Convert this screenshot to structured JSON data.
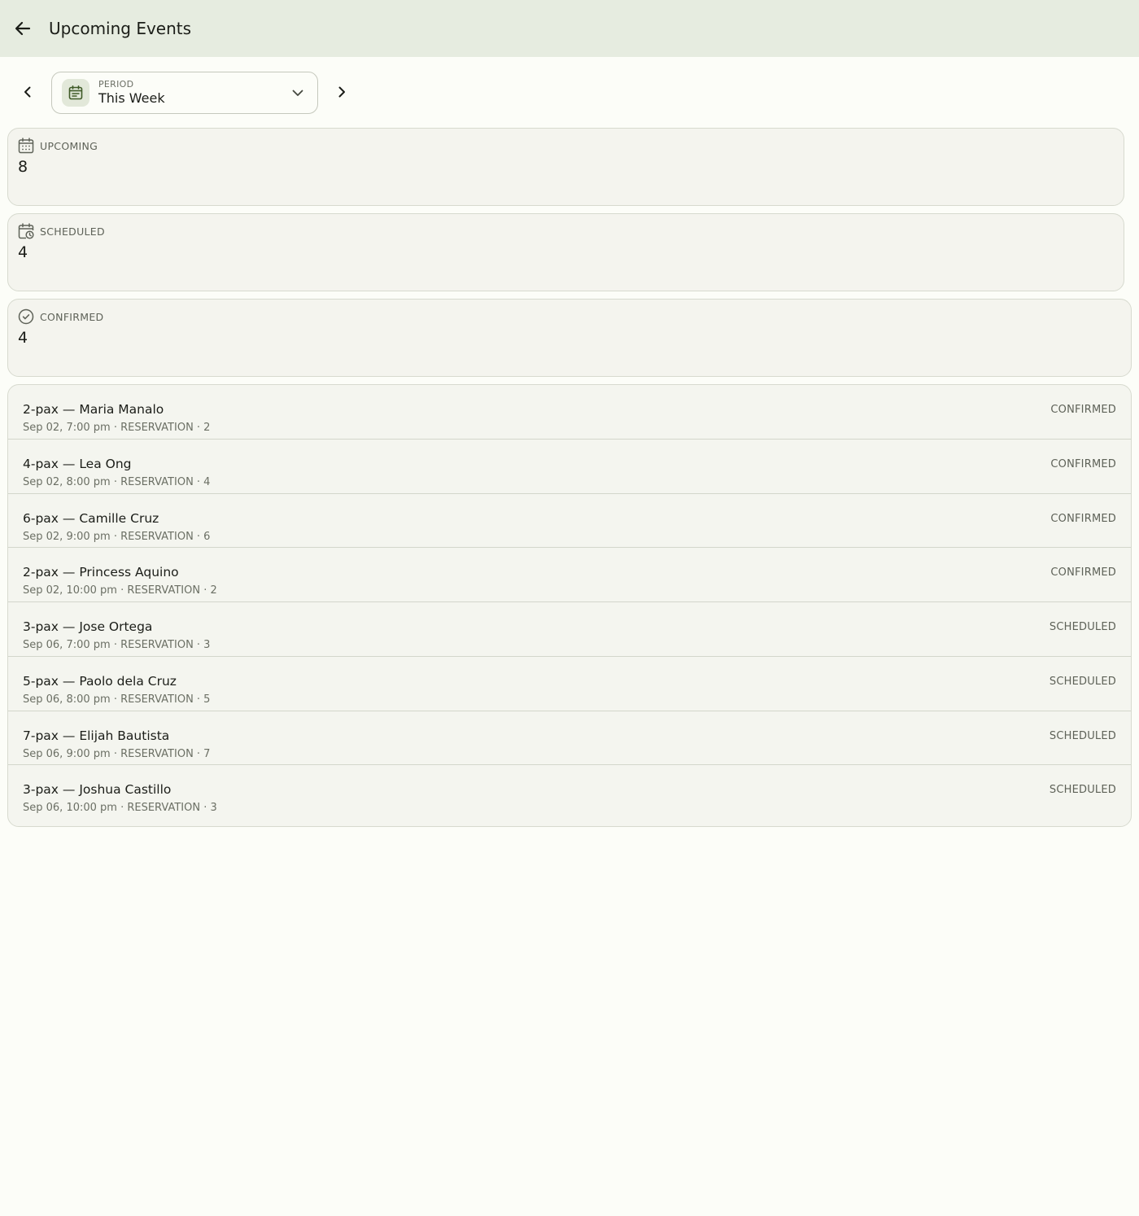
{
  "appbar": {
    "title": "Upcoming Events",
    "back_icon": "arrow-left-icon"
  },
  "period": {
    "label": "PERIOD",
    "value": "This Week",
    "icon": "calendar-list-icon",
    "prev_icon": "chevron-left-icon",
    "next_icon": "chevron-right-icon",
    "dropdown_icon": "chevron-down-icon"
  },
  "stats": [
    {
      "label": "UPCOMING",
      "value": "8",
      "icon": "calendar-grid-icon"
    },
    {
      "label": "SCHEDULED",
      "value": "4",
      "icon": "calendar-clock-icon"
    },
    {
      "label": "CONFIRMED",
      "value": "4",
      "icon": "check-circle-icon"
    }
  ],
  "events": [
    {
      "title": "2-pax — Maria Manalo",
      "subtitle": "Sep 02, 7:00 pm · RESERVATION · 2",
      "status": "CONFIRMED"
    },
    {
      "title": "4-pax — Lea Ong",
      "subtitle": "Sep 02, 8:00 pm · RESERVATION · 4",
      "status": "CONFIRMED"
    },
    {
      "title": "6-pax — Camille Cruz",
      "subtitle": "Sep 02, 9:00 pm · RESERVATION · 6",
      "status": "CONFIRMED"
    },
    {
      "title": "2-pax — Princess Aquino",
      "subtitle": "Sep 02, 10:00 pm · RESERVATION · 2",
      "status": "CONFIRMED"
    },
    {
      "title": "3-pax — Jose Ortega",
      "subtitle": "Sep 06, 7:00 pm · RESERVATION · 3",
      "status": "SCHEDULED"
    },
    {
      "title": "5-pax — Paolo dela Cruz",
      "subtitle": "Sep 06, 8:00 pm · RESERVATION · 5",
      "status": "SCHEDULED"
    },
    {
      "title": "7-pax — Elijah Bautista",
      "subtitle": "Sep 06, 9:00 pm · RESERVATION · 7",
      "status": "SCHEDULED"
    },
    {
      "title": "3-pax — Joshua Castillo",
      "subtitle": "Sep 06, 10:00 pm · RESERVATION · 3",
      "status": "SCHEDULED"
    }
  ],
  "colors": {
    "appbar_bg": "#e6ece0",
    "page_bg": "#fcfdf8",
    "card_bg": "#f4f4ee",
    "accent": "#4a6a2e"
  }
}
